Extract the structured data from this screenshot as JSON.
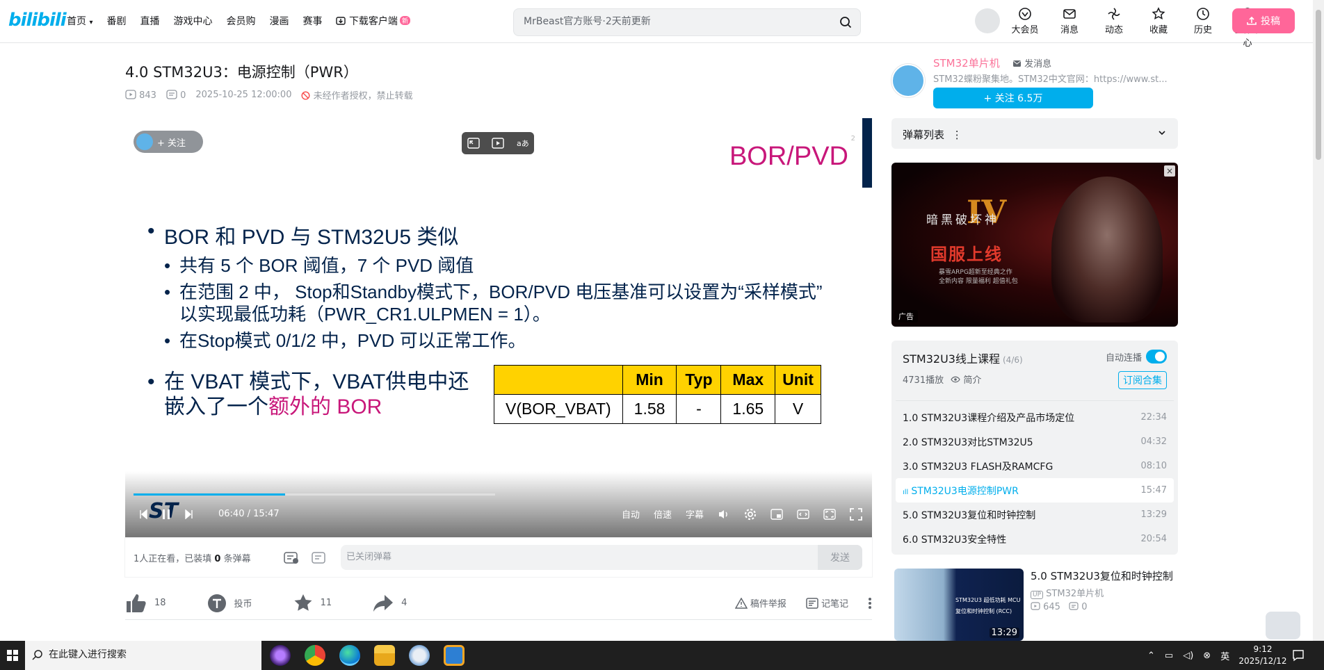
{
  "header": {
    "logo": "bilibili",
    "nav": [
      "首页",
      "番剧",
      "直播",
      "游戏中心",
      "会员购",
      "漫画",
      "赛事"
    ],
    "download_label": "下载客户端",
    "download_badge": "新",
    "search_placeholder": "MrBeast官方账号·2天前更新",
    "icons": [
      {
        "label": "大会员",
        "icon": "vip-icon"
      },
      {
        "label": "消息",
        "icon": "message-icon"
      },
      {
        "label": "动态",
        "icon": "dynamic-icon"
      },
      {
        "label": "收藏",
        "icon": "favorite-icon"
      },
      {
        "label": "历史",
        "icon": "history-icon"
      },
      {
        "label": "创作中心",
        "icon": "creator-icon"
      }
    ],
    "upload_label": "投稿"
  },
  "video": {
    "title": "4.0 STM32U3：电源控制（PWR）",
    "views": "843",
    "danmaku": "0",
    "date": "2025-10-25 12:00:00",
    "copyright": "未经作者授权，禁止转载"
  },
  "player": {
    "follow_label": "+ 关注",
    "slide_title": "BOR/PVD",
    "page_num": "2",
    "bullet1": "BOR 和 PVD 与 STM32U5 类似",
    "sub1": "共有 5 个 BOR 阈值，7 个 PVD 阈值",
    "sub2a": "在范围 2 中， Stop和Standby模式下，BOR/PVD 电压基准可以设置为“采样模式”",
    "sub2b": "以实现最低功耗（PWR_CR1.ULPMEN = 1）。",
    "sub3": "在Stop模式 0/1/2 中，PVD 可以正常工作。",
    "bullet2a": "在 VBAT 模式下，VBAT供电中还",
    "bullet2b": "嵌入了一个",
    "bullet2_hl": "额外的 BOR",
    "table": {
      "headers": [
        "",
        "Min",
        "Typ",
        "Max",
        "Unit"
      ],
      "row": [
        "V(BOR_VBAT)",
        "1.58",
        "-",
        "1.65",
        "V"
      ]
    },
    "current_time": "06:40",
    "sep": "/",
    "duration": "15:47",
    "progress": 0.42,
    "ctrl_labels": [
      "自动",
      "倍速",
      "字幕"
    ]
  },
  "danmaku_bar": {
    "viewer_prefix": "1人正在看，已装填 ",
    "count": "0",
    "viewer_suffix": " 条弹幕",
    "placeholder": "已关闭弹幕",
    "send": "发送"
  },
  "actions": {
    "like": "18",
    "coin": "投币",
    "fav": "11",
    "share": "4",
    "report": "稿件举报",
    "note": "记笔记"
  },
  "uploader": {
    "name": "STM32单片机",
    "msg": "发消息",
    "desc": "STM32蝶粉聚集地。STM32中文官网：https://www.st...",
    "follow": "+ 关注 6.5万"
  },
  "danmaku_list": {
    "label": "弹幕列表"
  },
  "ad": {
    "line1": "暗黑破坏神",
    "numeral": "IV",
    "line2": "国服上线",
    "line3": "暴雪ARPG超新至经典之作",
    "line4": "全新内容 限量福利 超值礼包",
    "tag": "广告"
  },
  "playlist": {
    "title": "STM32U3线上课程",
    "progress": "(4/6)",
    "auto_label": "自动连播",
    "plays": "4731播放",
    "intro": "简介",
    "subscribe": "订阅合集",
    "items": [
      {
        "title": "1.0 STM32U3课程介绍及产品市场定位",
        "duration": "22:34"
      },
      {
        "title": "2.0 STM32U3对比STM32U5",
        "duration": "04:32"
      },
      {
        "title": "3.0 STM32U3 FLASH及RAMCFG",
        "duration": "08:10"
      },
      {
        "title": "STM32U3电源控制PWR",
        "duration": "15:47"
      },
      {
        "title": "5.0 STM32U3复位和时钟控制",
        "duration": "13:29"
      },
      {
        "title": "6.0 STM32U3安全特性",
        "duration": "20:54"
      }
    ]
  },
  "recommend": {
    "title": "5.0 STM32U3复位和时钟控制",
    "channel": "STM32单片机",
    "views": "645",
    "comments": "0",
    "duration": "13:29",
    "thumb_text": "STM32U3 超低功耗 MCU 复位和时钟控制 (RCC)"
  },
  "taskbar": {
    "search_placeholder": "在此键入进行搜索",
    "time": "9:12",
    "date": "2025/12/12"
  }
}
